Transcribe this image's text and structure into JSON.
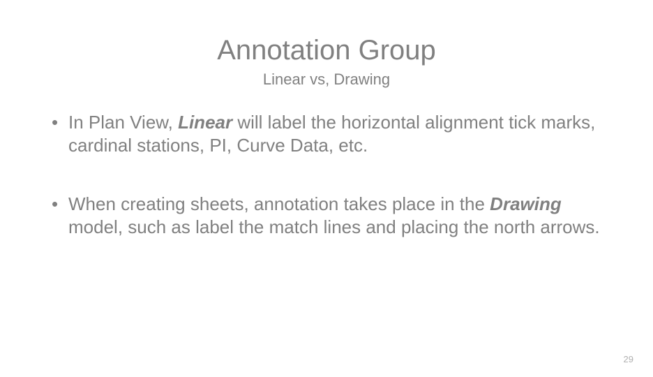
{
  "title": "Annotation Group",
  "subtitle": "Linear vs, Drawing",
  "bullets": [
    {
      "pre": "In Plan View, ",
      "emph": "Linear",
      "post": " will label the horizontal alignment tick marks, cardinal stations, PI, Curve Data, etc."
    },
    {
      "pre": "When creating sheets, annotation takes place in the ",
      "emph": "Drawing",
      "post": " model, such as label the match lines and placing the north arrows."
    }
  ],
  "page_number": "29"
}
